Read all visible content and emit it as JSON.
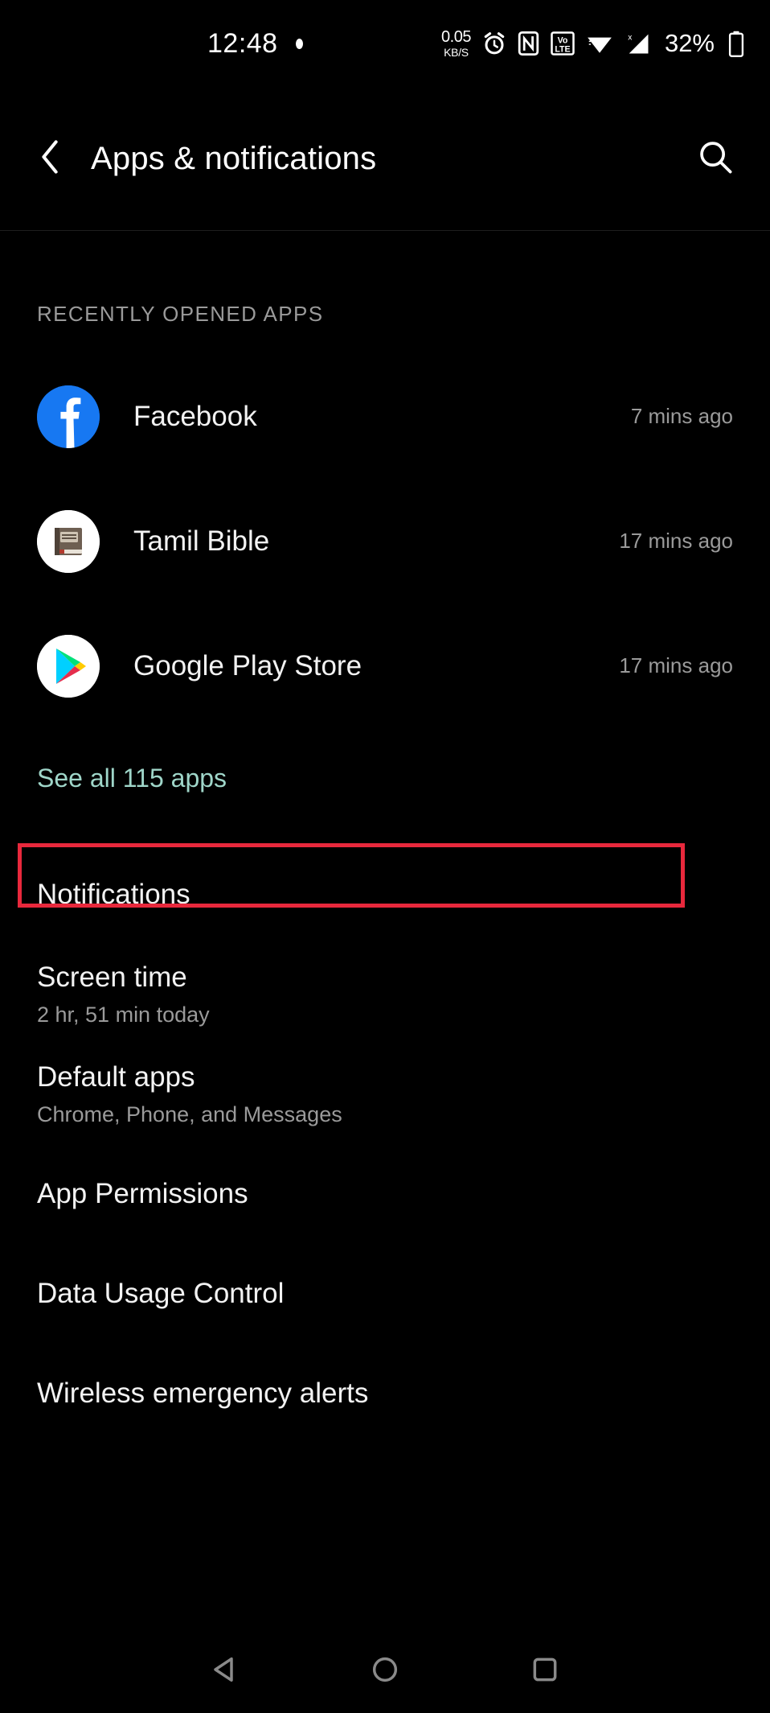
{
  "status_bar": {
    "time": "12:48",
    "dot_icon": "recording-dot-icon",
    "network_speed_value": "0.05",
    "network_speed_unit": "KB/S",
    "alarm_icon": "alarm-clock-icon",
    "nfc_icon": "nfc-icon",
    "volte_label_top": "Vo",
    "volte_label_bottom": "LTE",
    "wifi_icon": "wifi-icon",
    "signal_icon": "signal-no-service-icon",
    "signal_badge": "x",
    "battery_percent": "32%",
    "battery_icon": "battery-icon"
  },
  "app_bar": {
    "back_icon": "back-chevron-icon",
    "title": "Apps & notifications",
    "search_icon": "search-icon"
  },
  "recent_section": {
    "header": "RECENTLY OPENED APPS",
    "apps": [
      {
        "name": "Facebook",
        "time": "7 mins ago",
        "icon": "facebook-icon"
      },
      {
        "name": "Tamil Bible",
        "time": "17 mins ago",
        "icon": "tamil-bible-icon"
      },
      {
        "name": "Google Play Store",
        "time": "17 mins ago",
        "icon": "google-play-store-icon"
      }
    ],
    "see_all_label": "See all 115 apps"
  },
  "settings": [
    {
      "title": "Notifications",
      "subtitle": ""
    },
    {
      "title": "Screen time",
      "subtitle": "2 hr, 51 min today"
    },
    {
      "title": "Default apps",
      "subtitle": "Chrome, Phone, and Messages"
    },
    {
      "title": "App Permissions",
      "subtitle": ""
    },
    {
      "title": "Data Usage Control",
      "subtitle": ""
    },
    {
      "title": "Wireless emergency alerts",
      "subtitle": ""
    }
  ],
  "annotation": {
    "target": "Notifications",
    "color": "#e8283c"
  },
  "nav_bar": {
    "back_icon": "nav-back-triangle-icon",
    "home_icon": "nav-home-circle-icon",
    "recents_icon": "nav-recents-square-icon"
  },
  "colors": {
    "background": "#000000",
    "primary_text": "#f2f2f2",
    "secondary_text": "#9a9a9a",
    "accent_link": "#9fd6c9",
    "annotation_red": "#e8283c"
  }
}
